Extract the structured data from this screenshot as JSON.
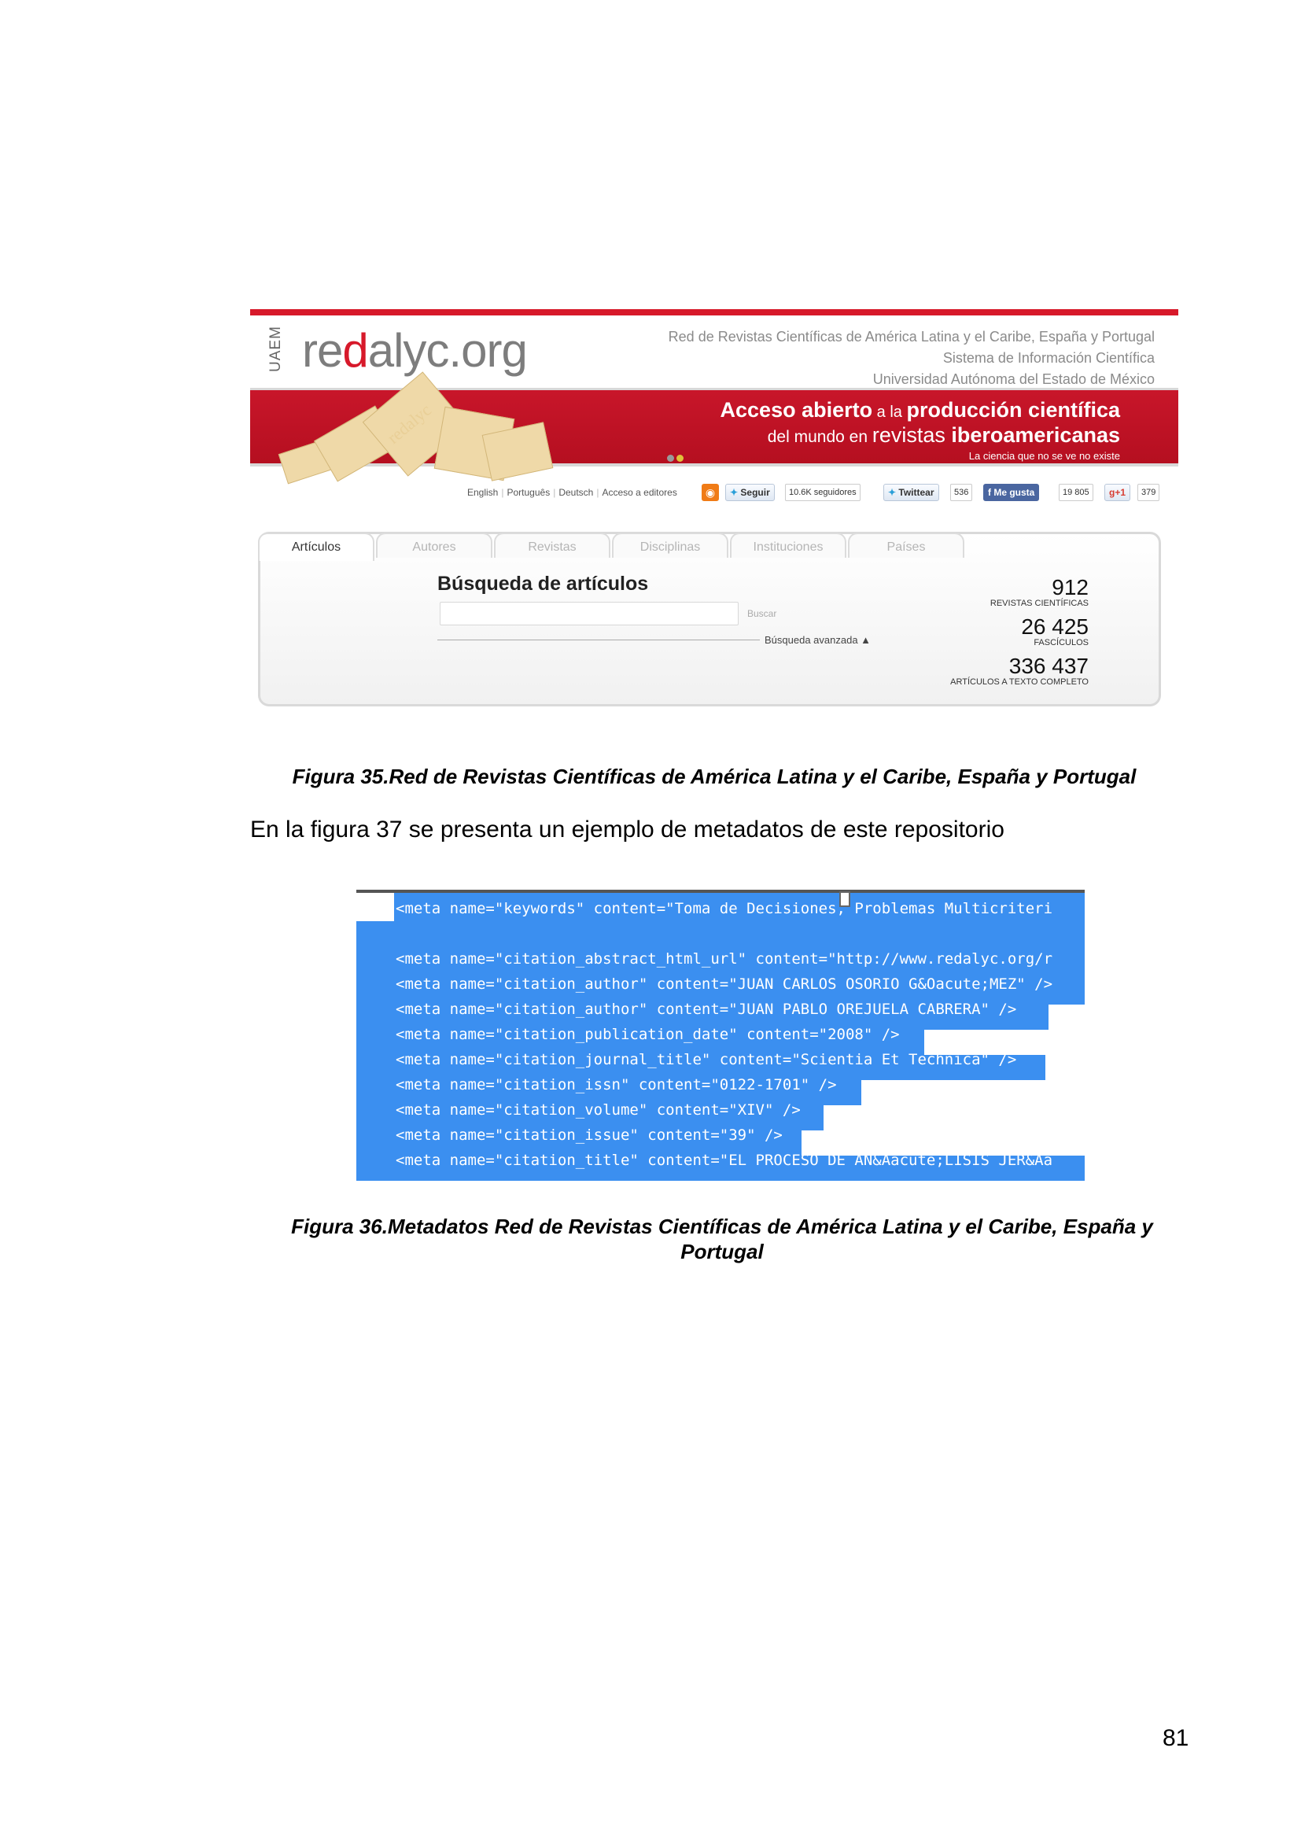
{
  "figure35": {
    "header": {
      "uaem": "UAEM",
      "logo_pre": "re",
      "logo_mark": "d",
      "logo_post": "alyc.org",
      "lines": [
        "Red de Revistas Científicas de América Latina y el Caribe, España y Portugal",
        "Sistema de Información Científica",
        "Universidad Autónoma del Estado de México"
      ]
    },
    "banner": {
      "line1_bold": "Acceso abierto",
      "line1_small": " a la ",
      "line1_bold2": "producción científica",
      "line2_a": "del mundo en ",
      "line2_b": "revistas",
      "line2_c": " iberoamericanas",
      "tagline": "La ciencia que no se ve no existe",
      "envelope_text": "redalyc",
      "dot_colors": [
        "#9a9a9a",
        "#e0c23a"
      ]
    },
    "toolbar": {
      "langs": [
        "English",
        "Português",
        "Deutsch",
        "Acceso a editores"
      ],
      "twitter_follow": "Seguir",
      "twitter_followers": "10.6K seguidores",
      "tweet": "Twittear",
      "tweet_count": "536",
      "fb_like": "Me gusta",
      "fb_count": "19 805",
      "gplus": "g+1",
      "gplus_count": "379"
    },
    "tabs": [
      "Artículos",
      "Autores",
      "Revistas",
      "Disciplinas",
      "Instituciones",
      "Países"
    ],
    "search": {
      "title": "Búsqueda de artículos",
      "button": "Buscar",
      "advanced": "Búsqueda avanzada ▲"
    },
    "stats": [
      {
        "value": "912",
        "label": "REVISTAS CIENTÍFICAS"
      },
      {
        "value": "26 425",
        "label": "FASCÍCULOS"
      },
      {
        "value": "336 437",
        "label": "ARTÍCULOS A TEXTO COMPLETO"
      }
    ],
    "caption": "Figura 35.Red de Revistas Científicas de América Latina y el Caribe, España y Portugal"
  },
  "paragraph": "En la figura 37 se presenta un ejemplo de metadatos de este repositorio",
  "figure36": {
    "selection_color": "#3b8ff0",
    "code_lines": [
      "<meta name=\"keywords\" content=\"Toma de Decisiones, Problemas Multicriteri",
      "",
      "<meta name=\"citation_abstract_html_url\" content=\"http://www.redalyc.org/r",
      "<meta name=\"citation_author\" content=\"JUAN CARLOS OSORIO G&Oacute;MEZ\" />",
      "<meta name=\"citation_author\" content=\"JUAN PABLO OREJUELA CABRERA\" />",
      "<meta name=\"citation_publication_date\" content=\"2008\" />",
      "<meta name=\"citation_journal_title\" content=\"Scientia Et Technica\" />",
      "<meta name=\"citation_issn\" content=\"0122-1701\" />",
      "<meta name=\"citation_volume\" content=\"XIV\" />",
      "<meta name=\"citation_issue\" content=\"39\" />",
      "<meta name=\"citation_title\" content=\"EL PROCESO DE AN&Aacute;LISIS JER&Aa"
    ],
    "caption_line1": "Figura 36.Metadatos Red de Revistas Científicas de América Latina y el Caribe, España y",
    "caption_line2": "Portugal"
  },
  "page_number": "81"
}
